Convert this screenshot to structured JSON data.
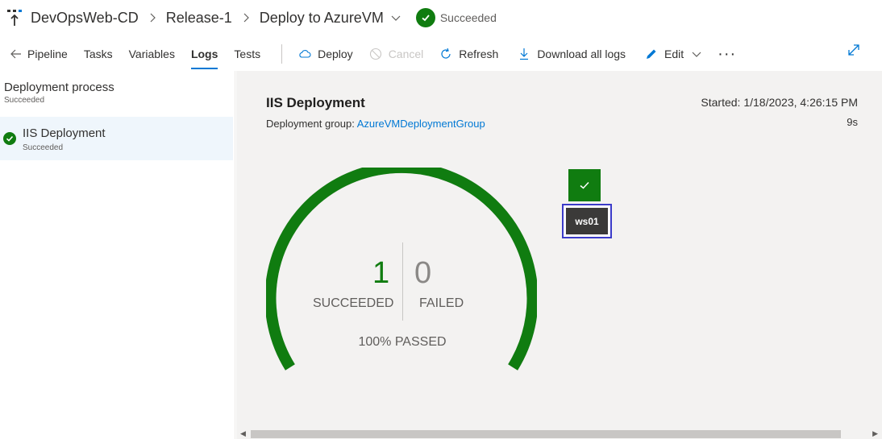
{
  "breadcrumb": {
    "pipeline": "DevOpsWeb-CD",
    "release": "Release-1",
    "stage": "Deploy to AzureVM",
    "status": "Succeeded"
  },
  "toolbar": {
    "pipeline": "Pipeline",
    "tasks": "Tasks",
    "variables": "Variables",
    "logs": "Logs",
    "tests": "Tests",
    "deploy": "Deploy",
    "cancel": "Cancel",
    "refresh": "Refresh",
    "download": "Download all logs",
    "edit": "Edit",
    "more": "···"
  },
  "sidebar": {
    "process_title": "Deployment process",
    "process_status": "Succeeded",
    "item_title": "IIS Deployment",
    "item_status": "Succeeded"
  },
  "job": {
    "title": "IIS Deployment",
    "group_label": "Deployment group:",
    "group_link": "AzureVMDeploymentGroup",
    "started": "Started: 1/18/2023, 4:26:15 PM",
    "duration": "9s"
  },
  "summary": {
    "succeeded_count": "1",
    "succeeded_label": "SUCCEEDED",
    "failed_count": "0",
    "failed_label": "FAILED",
    "passed": "100% PASSED",
    "pass_fraction": 1.0
  },
  "machine": {
    "name": "ws01"
  },
  "colors": {
    "success": "#107c10",
    "accent": "#0078d4",
    "selection": "#3b3bc9"
  },
  "icons": [
    "pipeline-icon",
    "chevron-right-icon",
    "chevron-down-icon",
    "check-icon",
    "arrow-left-icon",
    "cloud-icon",
    "cancel-icon",
    "refresh-icon",
    "download-icon",
    "pencil-icon",
    "expand-icon"
  ]
}
